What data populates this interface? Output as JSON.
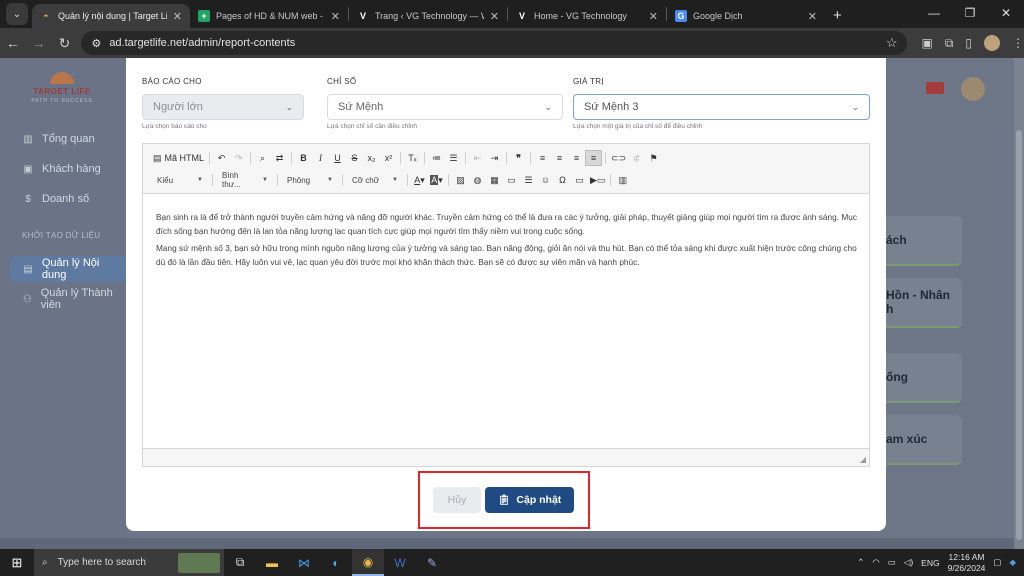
{
  "browser": {
    "tabs": [
      {
        "title": "Quản lý nội dung | Target Life",
        "active": true
      },
      {
        "title": "Pages of HD & NUM web - Goo"
      },
      {
        "title": "Trang ‹ VG Technology — Word"
      },
      {
        "title": "Home - VG Technology"
      },
      {
        "title": "Google Dịch"
      }
    ],
    "new_tab": "+",
    "url": "ad.targetlife.net/admin/report-contents"
  },
  "sidebar": {
    "logo": {
      "name": "TARGET LIFE",
      "tagline": "PATH TO SUCCESS"
    },
    "items": [
      {
        "label": "Tổng quan",
        "icon": "chart-icon"
      },
      {
        "label": "Khách hàng",
        "icon": "contacts-icon"
      },
      {
        "label": "Doanh số",
        "icon": "dollar-icon"
      }
    ],
    "section_heading": "KHỞI TẠO DỮ LIỆU",
    "items2": [
      {
        "label": "Quản lý Nội dung",
        "icon": "document-icon",
        "active": true
      },
      {
        "label": "Quản lý Thành viên",
        "icon": "users-icon"
      }
    ]
  },
  "background_cards": [
    "ách",
    "Hồn - Nhân\nh",
    "ống",
    "am xúc"
  ],
  "modal": {
    "fields": [
      {
        "label": "BÁO CÁO CHO",
        "value": "Người lớn",
        "hint": "Lựa chọn báo cáo cho",
        "disabled": true
      },
      {
        "label": "CHỈ SỐ",
        "value": "Sứ Mệnh",
        "hint": "Lựa chọn chỉ số cần điều chỉnh"
      },
      {
        "label": "GIÁ TRỊ",
        "value": "Sứ Mệnh 3",
        "hint": "Lựa chọn một giá trị của chỉ số để điều chỉnh"
      }
    ],
    "editor": {
      "source_label": "Mã HTML",
      "combos": {
        "style": "Kiểu",
        "format": "Bình thư...",
        "font": "Phông",
        "size": "Cỡ chữ"
      },
      "paragraphs": [
        "Bạn sinh ra là để trở thành người truyền cảm hứng và nâng đỡ người khác. Truyền cảm hứng có thể là đưa ra các ý tưởng, giải pháp, thuyết giảng giúp mọi người tìm ra được ánh sáng. Mục đích sống bạn hướng đến là lan tỏa năng lượng lạc quan tích cực giúp mọi người tìm thấy niềm vui trong cuộc sống.",
        "Mang sứ mệnh số 3, bạn sở hữu trong mình nguồn năng lượng của ý tưởng và sáng tạo. Bạn năng động, giỏi ăn nói và thu hút. Bạn có thể tỏa sáng khi được xuất hiện trước công chúng cho dù đó là lần đầu tiên. Hãy luôn vui vẻ, lạc quan yêu đời trước mọi khó khăn thách thức. Bạn sẽ có được sự viên mãn và hạnh phúc."
      ]
    },
    "buttons": {
      "cancel": "Hủy",
      "update": "Cập nhật"
    }
  },
  "taskbar": {
    "search_placeholder": "Type here to search",
    "lang": "ENG",
    "time": "12:16 AM",
    "date": "9/26/2024"
  },
  "colors": {
    "primary_button": "#1f4b82",
    "highlight_border": "#e0262c",
    "active_sidebar": "#5f7aa1"
  }
}
